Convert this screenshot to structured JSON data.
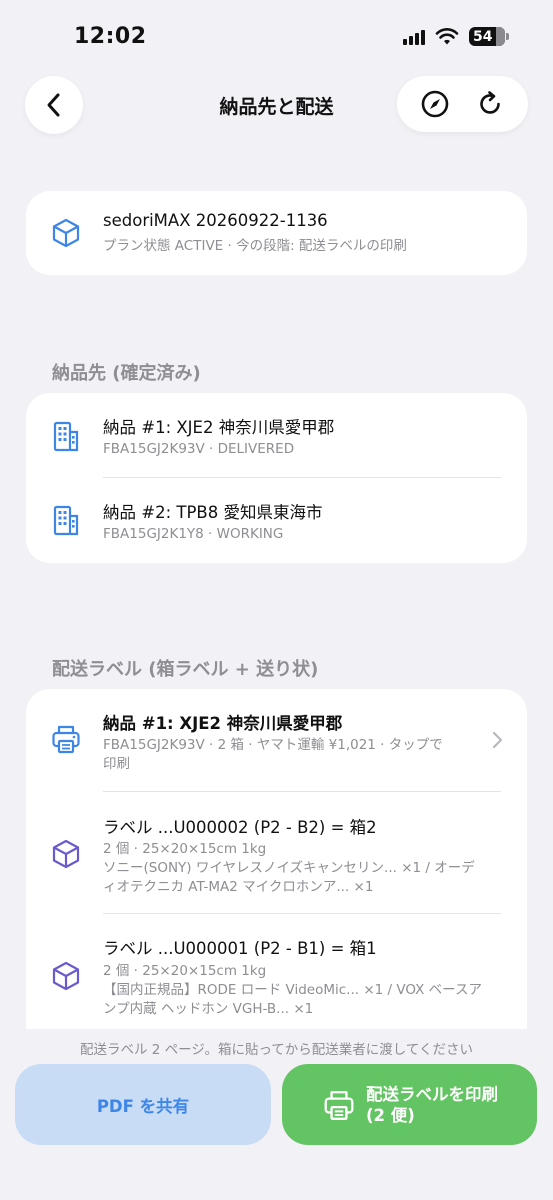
{
  "status_bar": {
    "time": "12:02",
    "battery": "54"
  },
  "nav": {
    "title": "納品先と配送"
  },
  "plan": {
    "title": "sedoriMAX 20260922-1136",
    "subtitle": "プラン状態 ACTIVE · 今の段階: 配送ラベルの印刷"
  },
  "destinations": {
    "header": "納品先 (確定済み)",
    "items": [
      {
        "title": "納品 #1: XJE2 神奈川県愛甲郡",
        "subtitle": "FBA15GJ2K93V · DELIVERED"
      },
      {
        "title": "納品 #2: TPB8 愛知県東海市",
        "subtitle": "FBA15GJ2K1Y8 · WORKING"
      }
    ]
  },
  "labels": {
    "header": "配送ラベル (箱ラベル + 送り状)",
    "shipment": {
      "title": "納品 #1: XJE2 神奈川県愛甲郡",
      "subtitle_line1": "FBA15GJ2K93V · 2 箱 · ヤマト運輸 ¥1,021 · タップで",
      "subtitle_line2": "印刷"
    },
    "boxes": [
      {
        "title": "ラベル ...U000002 (P2 - B2) = 箱2",
        "line1": "2 個 · 25×20×15cm 1kg",
        "line2": "ソニー(SONY) ワイヤレスノイズキャンセリン... ×1 / オーデ",
        "line3": "ィオテクニカ AT-MA2 マイクロホンア... ×1"
      },
      {
        "title": "ラベル ...U000001 (P2 - B1) = 箱1",
        "line1": "2 個 · 25×20×15cm 1kg",
        "line2": "【国内正規品】RODE ロード VideoMic... ×1 / VOX ベースア",
        "line3": "ンプ内蔵 ヘッドホン VGH-B... ×1"
      }
    ]
  },
  "footer": {
    "note": "配送ラベル 2 ページ。箱に貼ってから配送業者に渡してください",
    "share_label": "PDF を共有",
    "print_label_line1": "配送ラベルを印刷",
    "print_label_line2": "(2 便)"
  },
  "colors": {
    "accent_blue": "#3d86e8",
    "box_purple": "#6a5acd",
    "print_green": "#63c463",
    "share_bg": "#c8dcf5",
    "background": "#f2f1f6"
  },
  "icons": {
    "back": "chevron-left-icon",
    "compass": "compass-icon",
    "refresh": "refresh-icon",
    "plan": "cube-icon",
    "destination": "building-icon",
    "printer": "printer-icon",
    "box": "cube-icon",
    "chevron": "chevron-right-icon"
  }
}
